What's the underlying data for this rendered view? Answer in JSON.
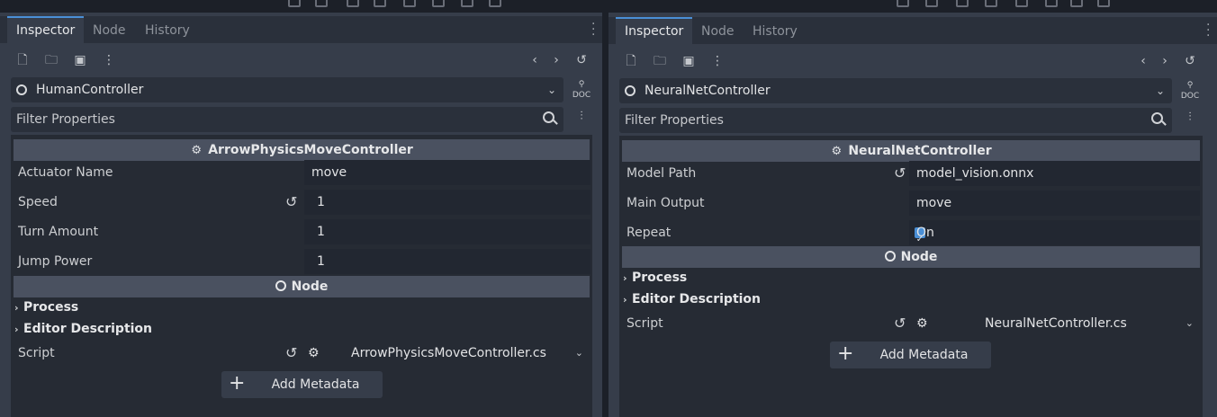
{
  "tabs": {
    "inspector": "Inspector",
    "node": "Node",
    "history": "History"
  },
  "left": {
    "object_name": "HumanController",
    "filter_placeholder": "Filter Properties",
    "section_title": "ArrowPhysicsMoveController",
    "properties": [
      {
        "label": "Actuator Name",
        "value": "move"
      },
      {
        "label": "Speed",
        "value": "1"
      },
      {
        "label": "Turn Amount",
        "value": "1"
      },
      {
        "label": "Jump Power",
        "value": "1"
      }
    ],
    "node_section": "Node",
    "process": "Process",
    "editor_description": "Editor Description",
    "script_label": "Script",
    "script_value": "ArrowPhysicsMoveController.cs",
    "add_metadata": "Add Metadata"
  },
  "right": {
    "object_name": "NeuralNetController",
    "filter_placeholder": "Filter Properties",
    "section_title": "NeuralNetController",
    "properties": [
      {
        "label": "Model Path",
        "value": "model_vision.onnx"
      },
      {
        "label": "Main Output",
        "value": "move"
      },
      {
        "label": "Repeat",
        "value": "On"
      }
    ],
    "node_section": "Node",
    "process": "Process",
    "editor_description": "Editor Description",
    "script_label": "Script",
    "script_value": "NeuralNetController.cs",
    "add_metadata": "Add Metadata"
  },
  "icons": {
    "new": "new-resource-icon",
    "open": "open-icon",
    "save": "save-icon",
    "more": "more-icon",
    "back": "chevron-left-icon",
    "forward": "chevron-right-icon",
    "history": "history-icon",
    "doc": "doc-icon",
    "search": "search-icon",
    "tune": "filter-options-icon",
    "reset": "reset-icon",
    "gear": "script-gear-icon",
    "dropdown": "chevron-down-icon"
  },
  "colors": {
    "accent": "#4a8fd6",
    "panel": "#363d4a",
    "content": "#262b34",
    "section": "#4a5160"
  }
}
